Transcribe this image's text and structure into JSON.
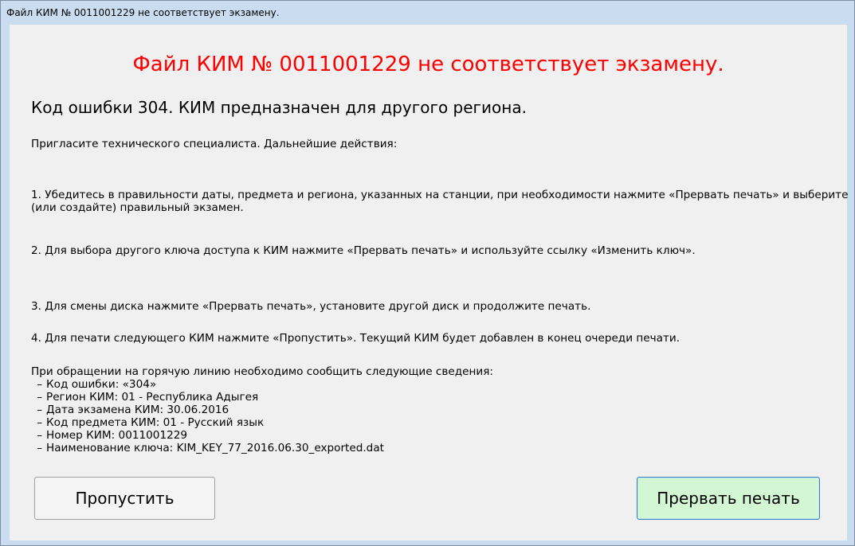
{
  "window": {
    "title": "Файл КИМ № 0011001229 не соответствует экзамену."
  },
  "message": {
    "heading": "Файл КИМ № 0011001229 не соответствует экзамену.",
    "subheading": "Код ошибки 304. КИМ предназначен для другого региона.",
    "invite": "Пригласите технического специалиста. Дальнейшие действия:",
    "step1": "1. Убедитесь в правильности даты, предмета и региона, указанных на станции, при необходимости нажмите «Прервать печать» и выберите (или создайте) правильный экзамен.",
    "step2": "2. Для выбора другого ключа доступа к КИМ нажмите «Прервать печать» и используйте ссылку «Изменить ключ».",
    "step3": "3. Для смены диска нажмите «Прервать печать», установите другой диск и продолжите печать.",
    "step4": "4. Для печати следующего КИМ нажмите «Пропустить». Текущий КИМ будет добавлен в конец очереди печати.",
    "hotline_intro": "При обращении на горячую линию необходимо сообщить следующие сведения:",
    "details": [
      "Код ошибки:  «304»",
      "Регион КИМ: 01 - Республика Адыгея",
      "Дата экзамена КИМ: 30.06.2016",
      "Код предмета КИМ: 01 - Русский язык",
      "Номер КИМ: 0011001229",
      "Наименование ключа: KIM_KEY_77_2016.06.30_exported.dat"
    ],
    "dash": "–"
  },
  "buttons": {
    "skip_label": "Пропустить",
    "abort_label": "Прервать печать"
  },
  "colors": {
    "heading": "#ff0000",
    "window_frame": "#c9dcf0",
    "content_bg": "#f0f0f0",
    "abort_button_bg": "#d2f7d2"
  }
}
